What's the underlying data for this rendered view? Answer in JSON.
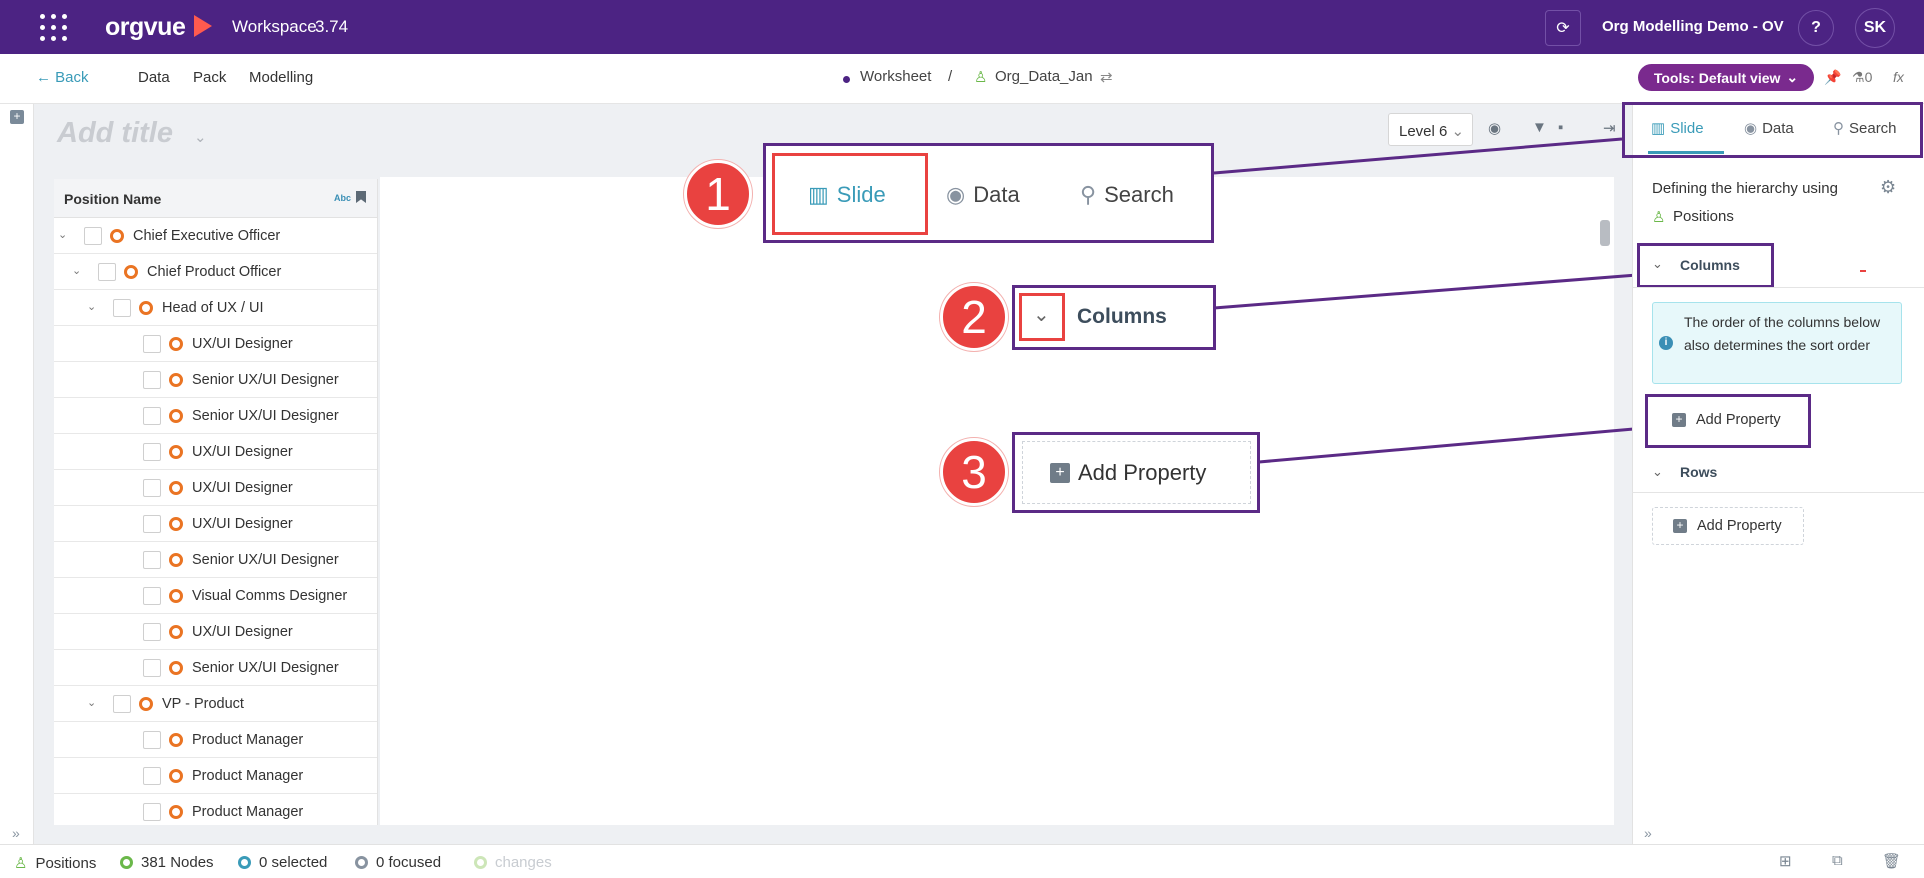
{
  "header": {
    "brand": "orgvue",
    "workspace": "Workspace",
    "version": "3.74",
    "org_name": "Org Modelling Demo - OV",
    "help": "?",
    "avatar": "SK",
    "icons": [
      "app-grid-icon",
      "sync-icon"
    ]
  },
  "subnav": {
    "back": "Back",
    "items": [
      "Data",
      "Pack",
      "Modelling"
    ],
    "breadcrumb_worksheet": "Worksheet",
    "breadcrumb_sep": "/",
    "breadcrumb_dataset": "Org_Data_Jan",
    "tools_label": "Tools: Default view",
    "flask_count": "0",
    "fx": "fx"
  },
  "workspace": {
    "title_placeholder": "Add title",
    "level": "Level 6"
  },
  "tree": {
    "column_header": "Position Name",
    "type_badge": "Abc",
    "rows": [
      {
        "label": "Chief Executive Officer",
        "depth": 0,
        "expandable": true
      },
      {
        "label": "Chief Product Officer",
        "depth": 1,
        "expandable": true
      },
      {
        "label": "Head of UX / UI",
        "depth": 2,
        "expandable": true
      },
      {
        "label": "UX/UI Designer",
        "depth": 3,
        "expandable": false
      },
      {
        "label": "Senior UX/UI Designer",
        "depth": 3,
        "expandable": false
      },
      {
        "label": "Senior UX/UI Designer",
        "depth": 3,
        "expandable": false
      },
      {
        "label": "UX/UI Designer",
        "depth": 3,
        "expandable": false
      },
      {
        "label": "UX/UI Designer",
        "depth": 3,
        "expandable": false
      },
      {
        "label": "UX/UI Designer",
        "depth": 3,
        "expandable": false
      },
      {
        "label": "Senior UX/UI Designer",
        "depth": 3,
        "expandable": false
      },
      {
        "label": "Visual Comms Designer",
        "depth": 3,
        "expandable": false
      },
      {
        "label": "UX/UI Designer",
        "depth": 3,
        "expandable": false
      },
      {
        "label": "Senior UX/UI Designer",
        "depth": 3,
        "expandable": false
      },
      {
        "label": "VP - Product",
        "depth": 2,
        "expandable": true
      },
      {
        "label": "Product Manager",
        "depth": 3,
        "expandable": false
      },
      {
        "label": "Product Manager",
        "depth": 3,
        "expandable": false
      },
      {
        "label": "Product Manager",
        "depth": 3,
        "expandable": false
      }
    ]
  },
  "callouts": {
    "one": "1",
    "two": "2",
    "three": "3",
    "zoom_tabs": [
      "Slide",
      "Data",
      "Search"
    ],
    "zoom_columns": "Columns",
    "zoom_add_property": "Add Property"
  },
  "right_panel": {
    "tabs": [
      "Slide",
      "Data",
      "Search"
    ],
    "hierarchy_text": "Defining the hierarchy using",
    "hierarchy_value": "Positions",
    "columns_label": "Columns",
    "info_text": "The order of the columns below also determines the sort order",
    "add_property": "Add Property",
    "rows_label": "Rows",
    "add_property_rows": "Add Property"
  },
  "status": {
    "positions": "Positions",
    "nodes": "381 Nodes",
    "selected": "0 selected",
    "focused": "0 focused",
    "changes": "changes"
  },
  "colors": {
    "header_bg": "#4c2383",
    "accent": "#3a9bb8",
    "callout_red": "#e94240",
    "node_orange": "#ea7423",
    "tools_purple": "#7a2a8e"
  }
}
